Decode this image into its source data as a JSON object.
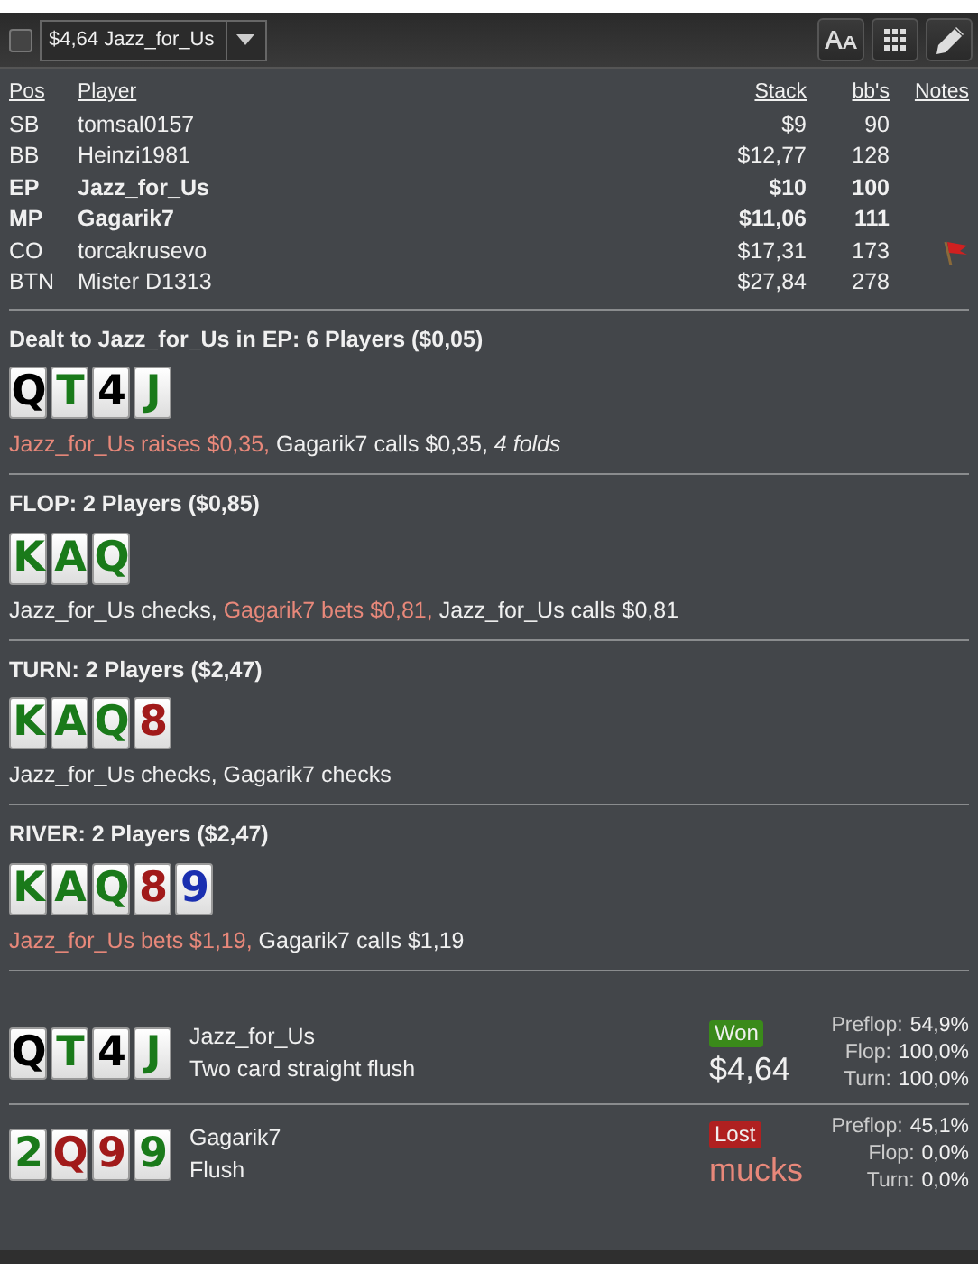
{
  "toolbar": {
    "checkbox": {
      "checked": false
    },
    "hand_select": {
      "value": "$4,64 Jazz_for_Us"
    },
    "buttons": [
      {
        "kind": "font"
      },
      {
        "kind": "grid"
      },
      {
        "kind": "edit"
      }
    ]
  },
  "players": {
    "columns": [
      "Pos",
      "Player",
      "Stack",
      "bb's",
      "Notes"
    ],
    "rows": [
      {
        "pos": "SB",
        "player": "tomsal0157",
        "stack": "$9",
        "bbs": "90",
        "bold": false,
        "note": false
      },
      {
        "pos": "BB",
        "player": "Heinzi1981",
        "stack": "$12,77",
        "bbs": "128",
        "bold": false,
        "note": false
      },
      {
        "pos": "EP",
        "player": "Jazz_for_Us",
        "stack": "$10",
        "bbs": "100",
        "bold": true,
        "note": false
      },
      {
        "pos": "MP",
        "player": "Gagarik7",
        "stack": "$11,06",
        "bbs": "111",
        "bold": true,
        "note": false
      },
      {
        "pos": "CO",
        "player": "torcakrusevo",
        "stack": "$17,31",
        "bbs": "173",
        "bold": false,
        "note": true
      },
      {
        "pos": "BTN",
        "player": "Mister D1313",
        "stack": "$27,84",
        "bbs": "278",
        "bold": false,
        "note": false
      }
    ]
  },
  "streets": [
    {
      "title": "Dealt to Jazz_for_Us in EP: 6 Players ($0,05)",
      "cards": [
        {
          "rank": "Q",
          "color": "#000000"
        },
        {
          "rank": "T",
          "color": "#1a7a1a"
        },
        {
          "rank": "4",
          "color": "#000000"
        },
        {
          "rank": "J",
          "color": "#1a7a1a"
        }
      ],
      "actions": [
        {
          "text": "Jazz_for_Us raises $0,35,",
          "kind": "hero"
        },
        {
          "text": "Gagarik7 calls $0,35,",
          "kind": "other"
        },
        {
          "text": "4 folds",
          "kind": "folds"
        }
      ]
    },
    {
      "title": "FLOP: 2 Players ($0,85)",
      "cards": [
        {
          "rank": "K",
          "color": "#1a7a1a"
        },
        {
          "rank": "A",
          "color": "#1a7a1a"
        },
        {
          "rank": "Q",
          "color": "#1a7a1a"
        }
      ],
      "actions": [
        {
          "text": "Jazz_for_Us checks,",
          "kind": "other"
        },
        {
          "text": "Gagarik7 bets $0,81,",
          "kind": "hero"
        },
        {
          "text": "Jazz_for_Us calls $0,81",
          "kind": "other"
        }
      ]
    },
    {
      "title": "TURN: 2 Players ($2,47)",
      "cards": [
        {
          "rank": "K",
          "color": "#1a7a1a"
        },
        {
          "rank": "A",
          "color": "#1a7a1a"
        },
        {
          "rank": "Q",
          "color": "#1a7a1a"
        },
        {
          "rank": "8",
          "color": "#a11a1a"
        }
      ],
      "actions": [
        {
          "text": "Jazz_for_Us checks, Gagarik7 checks",
          "kind": "other"
        }
      ]
    },
    {
      "title": "RIVER: 2 Players ($2,47)",
      "cards": [
        {
          "rank": "K",
          "color": "#1a7a1a"
        },
        {
          "rank": "A",
          "color": "#1a7a1a"
        },
        {
          "rank": "Q",
          "color": "#1a7a1a"
        },
        {
          "rank": "8",
          "color": "#a11a1a"
        },
        {
          "rank": "9",
          "color": "#1a2fb0"
        }
      ],
      "actions": [
        {
          "text": "Jazz_for_Us bets $1,19,",
          "kind": "hero"
        },
        {
          "text": "Gagarik7 calls $1,19",
          "kind": "other"
        }
      ]
    }
  ],
  "showdown": [
    {
      "cards": [
        {
          "rank": "Q",
          "color": "#000000"
        },
        {
          "rank": "T",
          "color": "#1a7a1a"
        },
        {
          "rank": "4",
          "color": "#000000"
        },
        {
          "rank": "J",
          "color": "#1a7a1a"
        }
      ],
      "player": "Jazz_for_Us",
      "hand": "Two card straight flush",
      "kind": "won",
      "badge": "Won",
      "amount": "$4,64",
      "equity": [
        {
          "label": "Preflop:",
          "value": "54,9%"
        },
        {
          "label": "Flop:",
          "value": "100,0%"
        },
        {
          "label": "Turn:",
          "value": "100,0%"
        }
      ]
    },
    {
      "cards": [
        {
          "rank": "2",
          "color": "#1a7a1a"
        },
        {
          "rank": "Q",
          "color": "#a11a1a"
        },
        {
          "rank": "9",
          "color": "#a11a1a"
        },
        {
          "rank": "9",
          "color": "#1a7a1a"
        }
      ],
      "player": "Gagarik7",
      "hand": "Flush",
      "kind": "lost",
      "badge": "Lost",
      "amount": "mucks",
      "equity": [
        {
          "label": "Preflop:",
          "value": "45,1%"
        },
        {
          "label": "Flop:",
          "value": "0,0%"
        },
        {
          "label": "Turn:",
          "value": "0,0%"
        }
      ]
    }
  ]
}
